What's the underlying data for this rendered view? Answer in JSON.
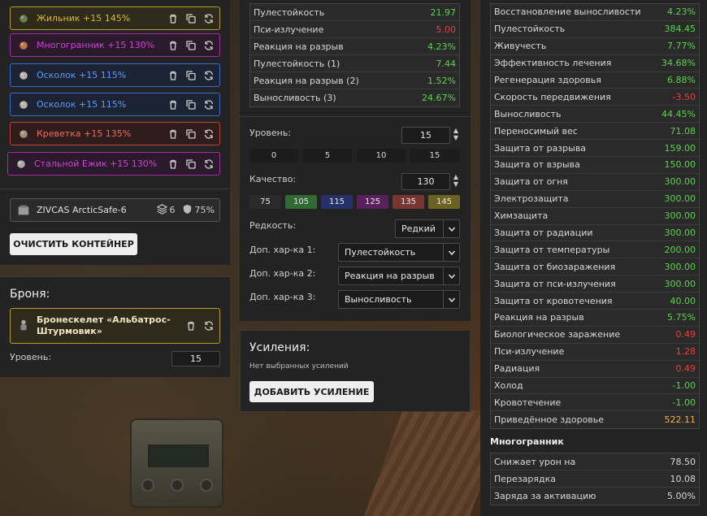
{
  "artifacts": [
    {
      "label": "Жильник +15 145%",
      "icon": "jilnik-icon",
      "color": "yellow"
    },
    {
      "label": "Многогранник +15 130%",
      "icon": "mnogogrannik-icon",
      "color": "purple"
    },
    {
      "label": "Осколок +15 115%",
      "icon": "oskolok-icon",
      "color": "blue"
    },
    {
      "label": "Осколок +15 115%",
      "icon": "oskolok-icon",
      "color": "blue"
    },
    {
      "label": "Креветка +15 135%",
      "icon": "krevetka-icon",
      "color": "red"
    },
    {
      "label": "Стальной Ежик +15 130%",
      "icon": "steel-hedgehog-icon",
      "color": "purple"
    }
  ],
  "container": {
    "name": "ZIVCAS ArcticSafe-6",
    "slots": "6",
    "protection": "75%"
  },
  "clear_button": "ОЧИСТИТЬ КОНТЕЙНЕР",
  "armor": {
    "title": "Броня:",
    "name": "Бронескелет «Альбатрос-Штурмовик»",
    "level_label": "Уровень:",
    "level_value": "15"
  },
  "artifact_stats": [
    {
      "name": "Пулестойкость",
      "value": "21.97",
      "tone": "g"
    },
    {
      "name": "Пси-излучение",
      "value": "5.00",
      "tone": "r"
    },
    {
      "name": "Реакция на разрыв",
      "value": "4.23%",
      "tone": "g"
    },
    {
      "name": "Пулестойкость (1)",
      "value": "7.44",
      "tone": "g"
    },
    {
      "name": "Реакция на разрыв (2)",
      "value": "1.52%",
      "tone": "g"
    },
    {
      "name": "Выносливость (3)",
      "value": "24.67%",
      "tone": "g"
    }
  ],
  "editor": {
    "level_label": "Уровень:",
    "level_value": "15",
    "level_presets": [
      "0",
      "5",
      "10",
      "15"
    ],
    "quality_label": "Качество:",
    "quality_value": "130",
    "quality_presets": [
      {
        "label": "75",
        "color": "#2a2a2a"
      },
      {
        "label": "105",
        "color": "#2f6b32"
      },
      {
        "label": "115",
        "color": "#26306a"
      },
      {
        "label": "125",
        "color": "#5a1f5e"
      },
      {
        "label": "135",
        "color": "#7a3533"
      },
      {
        "label": "145",
        "color": "#6e6220"
      }
    ],
    "rarity_label": "Редкость:",
    "rarity_value": "Редкий",
    "extra1_label": "Доп. хар-ка 1:",
    "extra1_value": "Пулестойкость",
    "extra2_label": "Доп. хар-ка 2:",
    "extra2_value": "Реакция на разрыв",
    "extra3_label": "Доп. хар-ка 3:",
    "extra3_value": "Выносливость"
  },
  "boosts": {
    "title": "Усиления:",
    "empty_text": "Нет выбранных усилений",
    "add_button": "ДОБАВИТЬ УСИЛЕНИЕ"
  },
  "total_stats": [
    {
      "name": "Восстановление выносливости",
      "value": "4.23%",
      "tone": "g"
    },
    {
      "name": "Пулестойкость",
      "value": "384.45",
      "tone": "g"
    },
    {
      "name": "Живучесть",
      "value": "7.77%",
      "tone": "g"
    },
    {
      "name": "Эффективность лечения",
      "value": "34.68%",
      "tone": "g"
    },
    {
      "name": "Регенерация здоровья",
      "value": "6.88%",
      "tone": "g"
    },
    {
      "name": "Скорость передвижения",
      "value": "-3.50",
      "tone": "r"
    },
    {
      "name": "Выносливость",
      "value": "44.45%",
      "tone": "g"
    },
    {
      "name": "Переносимый вес",
      "value": "71.08",
      "tone": "g"
    },
    {
      "name": "Защита от разрыва",
      "value": "159.00",
      "tone": "g"
    },
    {
      "name": "Защита от взрыва",
      "value": "150.00",
      "tone": "g"
    },
    {
      "name": "Защита от огня",
      "value": "300.00",
      "tone": "g"
    },
    {
      "name": "Электрозащита",
      "value": "300.00",
      "tone": "g"
    },
    {
      "name": "Химзащита",
      "value": "300.00",
      "tone": "g"
    },
    {
      "name": "Защита от радиации",
      "value": "300.00",
      "tone": "g"
    },
    {
      "name": "Защита от температуры",
      "value": "200.00",
      "tone": "g"
    },
    {
      "name": "Защита от биозаражения",
      "value": "300.00",
      "tone": "g"
    },
    {
      "name": "Защита от пси-излучения",
      "value": "300.00",
      "tone": "g"
    },
    {
      "name": "Защита от кровотечения",
      "value": "40.00",
      "tone": "g"
    },
    {
      "name": "Реакция на разрыв",
      "value": "5.75%",
      "tone": "g"
    },
    {
      "name": "Биологическое заражение",
      "value": "0.49",
      "tone": "r"
    },
    {
      "name": "Пси-излучение",
      "value": "1.28",
      "tone": "r"
    },
    {
      "name": "Радиация",
      "value": "0.49",
      "tone": "r"
    },
    {
      "name": "Холод",
      "value": "-1.00",
      "tone": "g"
    },
    {
      "name": "Кровотечение",
      "value": "-1.00",
      "tone": "g"
    },
    {
      "name": "Приведённое здоровье",
      "value": "522.11",
      "tone": "o"
    }
  ],
  "artifact_info": {
    "title": "Многогранник",
    "rows": [
      {
        "name": "Снижает урон на",
        "value": "78.50"
      },
      {
        "name": "Перезарядка",
        "value": "10.08"
      },
      {
        "name": "Заряда за активацию",
        "value": "5.00%"
      }
    ]
  }
}
